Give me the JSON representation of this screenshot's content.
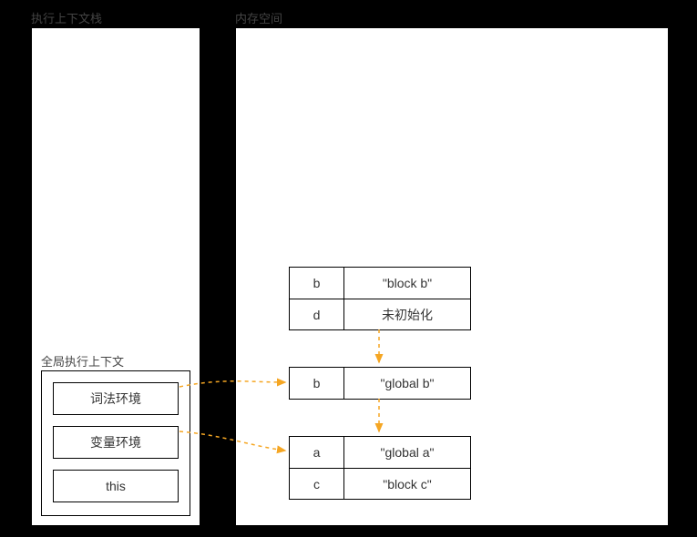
{
  "labels": {
    "stack_title": "执行上下文栈",
    "memory_title": "内存空间",
    "global_context": "全局执行上下文"
  },
  "context_slots": {
    "lexical": "词法环境",
    "variable": "变量环境",
    "this": "this"
  },
  "tables": {
    "block_scope": {
      "rows": [
        {
          "key": "b",
          "val": "\"block b\""
        },
        {
          "key": "d",
          "val": "未初始化"
        }
      ]
    },
    "lexical_env": {
      "rows": [
        {
          "key": "b",
          "val": "\"global b\""
        }
      ]
    },
    "variable_env": {
      "rows": [
        {
          "key": "a",
          "val": "\"global a\""
        },
        {
          "key": "c",
          "val": "\"block c\""
        }
      ]
    }
  },
  "colors": {
    "arrow": "#f5a623"
  }
}
